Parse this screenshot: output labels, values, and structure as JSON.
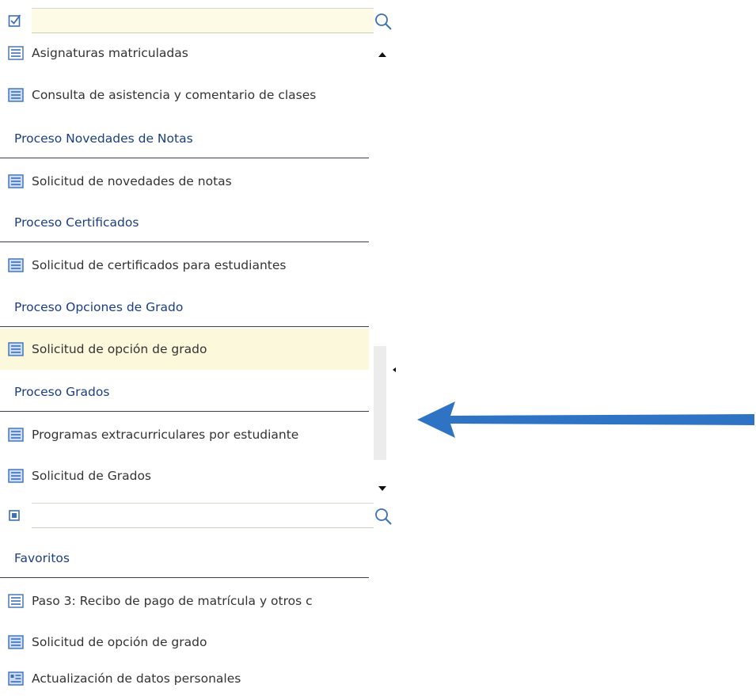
{
  "search_top": {
    "placeholder": "",
    "value": ""
  },
  "upper_list": {
    "items": [
      {
        "label": "Asignaturas matriculadas"
      },
      {
        "label": "Consulta de asistencia y comentario de clases"
      },
      {
        "label": "Proceso Novedades de Notas"
      },
      {
        "label": "Solicitud de novedades de notas"
      },
      {
        "label": "Proceso Certificados"
      },
      {
        "label": "Solicitud de certificados para estudiantes"
      },
      {
        "label": "Proceso Opciones de Grado"
      },
      {
        "label": "Solicitud de opción de grado"
      },
      {
        "label": "Proceso Grados"
      },
      {
        "label": "Programas extracurriculares por estudiante"
      },
      {
        "label": "Solicitud de Grados"
      }
    ]
  },
  "search_bottom": {
    "placeholder": "",
    "value": ""
  },
  "favorites": {
    "header": "Favoritos",
    "items": [
      {
        "label": "Paso 3: Recibo de pago de matrícula y otros c"
      },
      {
        "label": "Solicitud de opción de grado"
      },
      {
        "label": "Actualización de datos personales"
      }
    ]
  },
  "colors": {
    "section_text": "#1b3e86",
    "highlight_row": "#fbf8dc",
    "doc_icon": "#3d6fb5",
    "annotation_arrow": "#2f74c4"
  },
  "icons": {
    "top_lead": "checkbox-icon",
    "search": "search-icon",
    "list_item": "document-list-icon",
    "bottom_lead": "square-icon",
    "annotation": "left-arrow-icon"
  }
}
